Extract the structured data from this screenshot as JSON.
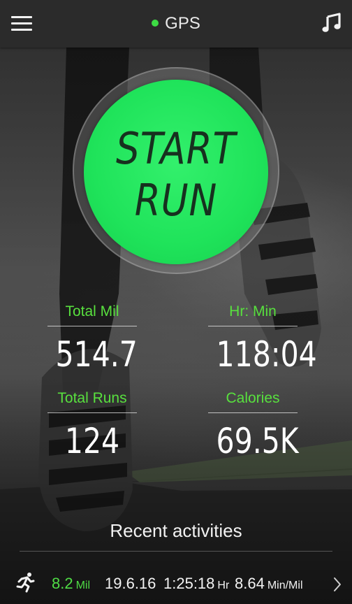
{
  "topbar": {
    "gps_label": "GPS",
    "gps_status_color": "#3ddc44",
    "menu_icon": "hamburger-menu-icon",
    "music_icon": "music-note-icon"
  },
  "start": {
    "line1": "START",
    "line2": "RUN",
    "color": "#1fe35a"
  },
  "stats": [
    {
      "label": "Total Mil",
      "value": "514.7"
    },
    {
      "label": "Hr: Min",
      "value": "118:04"
    },
    {
      "label": "Total Runs",
      "value": "124"
    },
    {
      "label": "Calories",
      "value": "69.5K"
    }
  ],
  "recent": {
    "title": "Recent activities",
    "items": [
      {
        "icon": "runner-icon",
        "distance": "8.2",
        "distance_unit": "Mil",
        "date": "19.6.16",
        "duration": "1:25:18",
        "duration_unit": "Hr",
        "pace": "8.64",
        "pace_unit": "Min/Mil"
      }
    ]
  },
  "colors": {
    "accent": "#58e03e",
    "topbar_bg": "#2b2b2b",
    "text": "#ffffff"
  }
}
